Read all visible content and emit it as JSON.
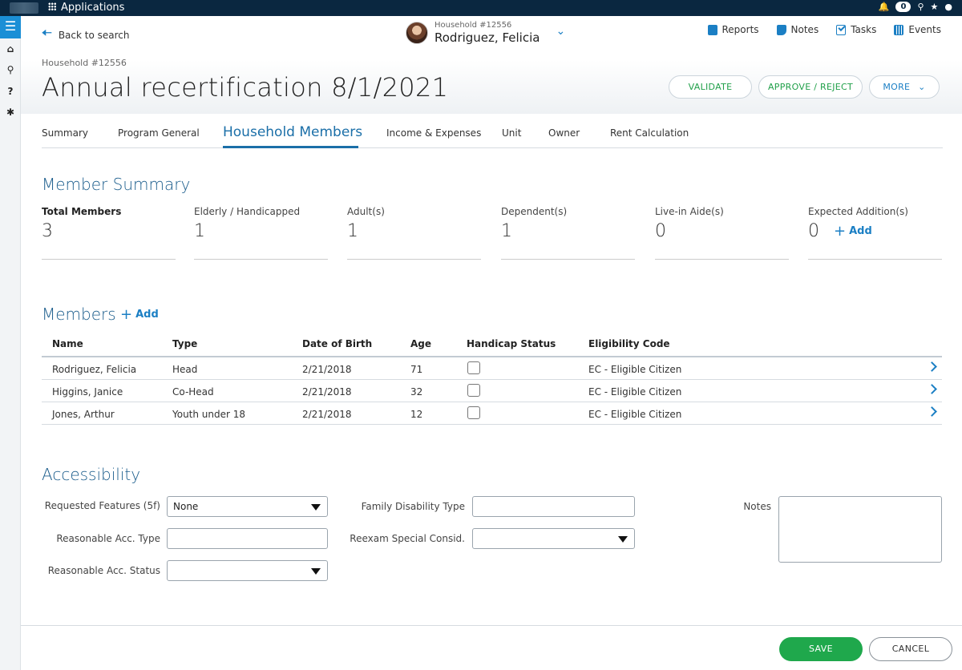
{
  "topbar": {
    "apps_label": "Applications",
    "notif_count": "0"
  },
  "header": {
    "back_label": "Back to search",
    "household_small": "Household #12556",
    "person_name": "Rodriguez, Felicia",
    "toolbar": {
      "reports": "Reports",
      "notes": "Notes",
      "tasks": "Tasks",
      "events": "Events"
    },
    "household_id": "Household #12556",
    "title": "Annual recertification 8/1/2021",
    "buttons": {
      "validate": "VALIDATE",
      "approve": "APPROVE / REJECT",
      "more": "MORE"
    }
  },
  "tabs": [
    "Summary",
    "Program General",
    "Household Members",
    "Income & Expenses",
    "Unit",
    "Owner",
    "Rent Calculation"
  ],
  "member_summary": {
    "heading": "Member Summary",
    "stats": [
      {
        "label": "Total Members",
        "value": "3"
      },
      {
        "label": "Elderly / Handicapped",
        "value": "1"
      },
      {
        "label": "Adult(s)",
        "value": "1"
      },
      {
        "label": "Dependent(s)",
        "value": "1"
      },
      {
        "label": "Live-in Aide(s)",
        "value": "0"
      },
      {
        "label": "Expected Addition(s)",
        "value": "0"
      }
    ],
    "add_label": "Add"
  },
  "members": {
    "heading": "Members",
    "add_label": "Add",
    "columns": [
      "Name",
      "Type",
      "Date of Birth",
      "Age",
      "Handicap Status",
      "Eligibility Code"
    ],
    "rows": [
      {
        "name": "Rodriguez, Felicia",
        "type": "Head",
        "dob": "2/21/2018",
        "age": "71",
        "handicap": false,
        "code": "EC - Eligible Citizen"
      },
      {
        "name": "Higgins, Janice",
        "type": "Co-Head",
        "dob": "2/21/2018",
        "age": "32",
        "handicap": false,
        "code": "EC - Eligible Citizen"
      },
      {
        "name": "Jones, Arthur",
        "type": "Youth under 18",
        "dob": "2/21/2018",
        "age": "12",
        "handicap": false,
        "code": "EC - Eligible Citizen"
      }
    ]
  },
  "accessibility": {
    "heading": "Accessibility",
    "requested_features_label": "Requested Features (5f)",
    "requested_features_value": "None",
    "reasonable_acc_type_label": "Reasonable Acc. Type",
    "reasonable_acc_type_value": "",
    "reasonable_acc_status_label": "Reasonable Acc. Status",
    "reasonable_acc_status_value": "",
    "family_disability_label": "Family Disability Type",
    "family_disability_value": "",
    "reexam_label": "Reexam Special Consid.",
    "reexam_value": "",
    "notes_label": "Notes",
    "notes_value": ""
  },
  "footer": {
    "save": "SAVE",
    "cancel": "CANCEL"
  },
  "colors": {
    "accent": "#1b7fc4",
    "heading": "#1b5d8c",
    "success": "#1fa84c",
    "topbar": "#0a2740"
  }
}
